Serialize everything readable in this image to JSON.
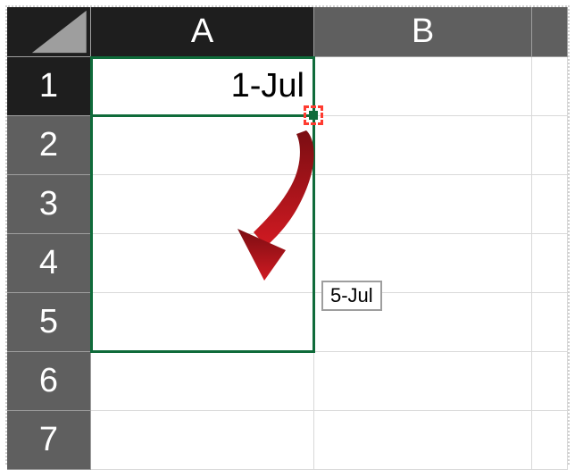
{
  "columns": [
    "A",
    "B",
    ""
  ],
  "rows": [
    "1",
    "2",
    "3",
    "4",
    "5",
    "6",
    "7"
  ],
  "activeColumn": 0,
  "activeRow": 0,
  "cells": {
    "A1": "1-Jul"
  },
  "fillTooltip": "5-Jul",
  "selection": {
    "fromRow": 0,
    "toRow": 4,
    "col": 0
  },
  "colors": {
    "selectionBorder": "#0f6b3a",
    "arrow": "#b3121a",
    "highlightDash": "#ff3b30"
  }
}
